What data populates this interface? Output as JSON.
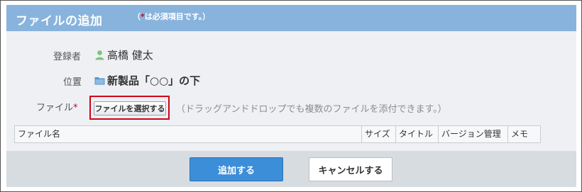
{
  "header": {
    "title": "ファイルの追加",
    "note_prefix": "（",
    "note_star": "*",
    "note_suffix": "は必須項目です。）"
  },
  "form": {
    "registrant_label": "登録者",
    "registrant_value": "高橋 健太",
    "location_label": "位置",
    "location_value": "新製品「○○」の下",
    "file_label": "ファイル",
    "file_required_mark": "*",
    "file_button_label": "ファイルを選択する",
    "dnd_hint": "（ドラッグアンドドロップでも複数のファイルを添付できます。）"
  },
  "file_table": {
    "columns": [
      "ファイル名",
      "サイズ",
      "タイトル",
      "バージョン管理",
      "メモ"
    ]
  },
  "footer": {
    "submit_label": "追加する",
    "cancel_label": "キャンセルする"
  },
  "icons": {
    "user": "user-icon",
    "folder": "folder-icon"
  },
  "colors": {
    "header_bg": "#88b3dd",
    "required": "#d0021b",
    "primary_button": "#3d8ed8",
    "highlight": "#d0021b"
  }
}
